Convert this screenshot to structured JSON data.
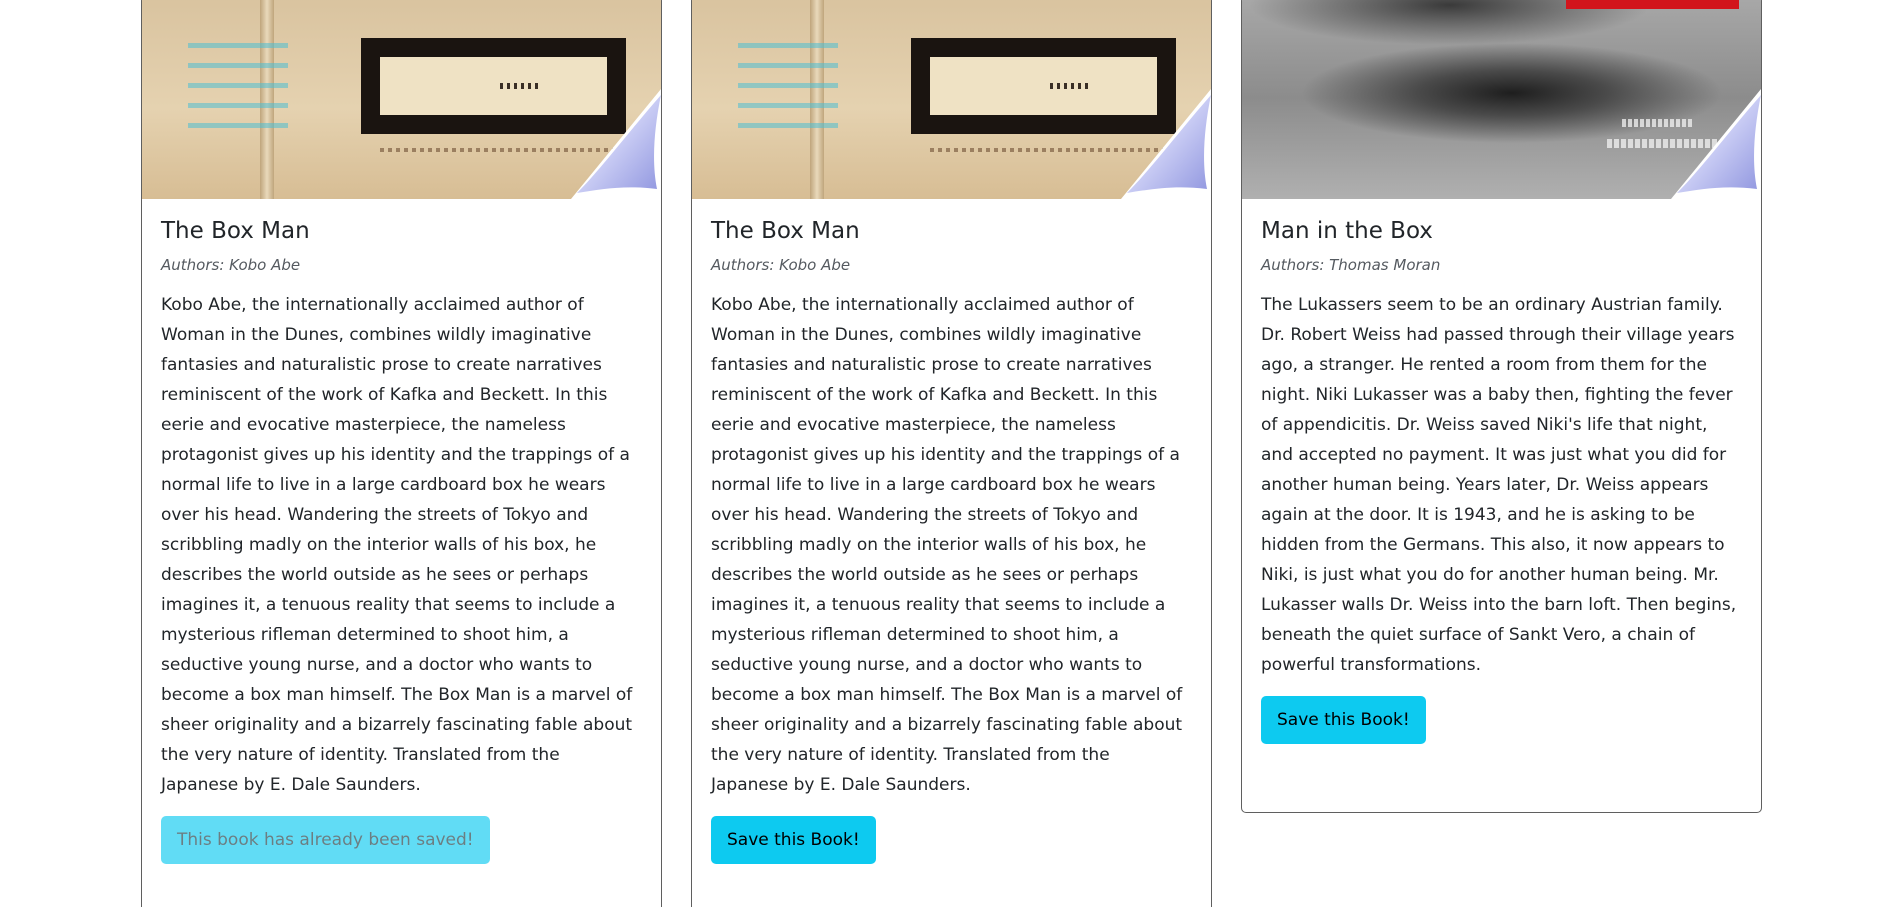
{
  "books": [
    {
      "title": "The Box Man",
      "authors": "Authors: Kobo Abe",
      "description": "Kobo Abe, the internationally acclaimed author of Woman in the Dunes, combines wildly imaginative fantasies and naturalistic prose to create narratives reminiscent of the work of Kafka and Beckett. In this eerie and evocative masterpiece, the nameless protagonist gives up his identity and the trappings of a normal life to live in a large cardboard box he wears over his head. Wandering the streets of Tokyo and scribbling madly on the interior walls of his box, he describes the world outside as he sees or perhaps imagines it, a tenuous reality that seems to include a mysterious rifleman determined to shoot him, a seductive young nurse, and a doctor who wants to become a box man himself. The Box Man is a marvel of sheer originality and a bizarrely fascinating fable about the very nature of identity. Translated from the Japanese by E. Dale Saunders.",
      "button_label": "This book has already been saved!",
      "saved": true,
      "cover_icon": "book-cover-image"
    },
    {
      "title": "The Box Man",
      "authors": "Authors: Kobo Abe",
      "description": "Kobo Abe, the internationally acclaimed author of Woman in the Dunes, combines wildly imaginative fantasies and naturalistic prose to create narratives reminiscent of the work of Kafka and Beckett. In this eerie and evocative masterpiece, the nameless protagonist gives up his identity and the trappings of a normal life to live in a large cardboard box he wears over his head. Wandering the streets of Tokyo and scribbling madly on the interior walls of his box, he describes the world outside as he sees or perhaps imagines it, a tenuous reality that seems to include a mysterious rifleman determined to shoot him, a seductive young nurse, and a doctor who wants to become a box man himself. The Box Man is a marvel of sheer originality and a bizarrely fascinating fable about the very nature of identity. Translated from the Japanese by E. Dale Saunders.",
      "button_label": "Save this Book!",
      "saved": false,
      "cover_icon": "book-cover-image"
    },
    {
      "title": "Man in the Box",
      "authors": "Authors: Thomas Moran",
      "description": "The Lukassers seem to be an ordinary Austrian family. Dr. Robert Weiss had passed through their village years ago, a stranger. He rented a room from them for the night. Niki Lukasser was a baby then, fighting the fever of appendicitis. Dr. Weiss saved Niki's life that night, and accepted no payment. It was just what you did for another human being. Years later, Dr. Weiss appears again at the door. It is 1943, and he is asking to be hidden from the Germans. This also, it now appears to Niki, is just what you do for another human being. Mr. Lukasser walls Dr. Weiss into the barn loft. Then begins, beneath the quiet surface of Sankt Vero, a chain of powerful transformations.",
      "button_label": "Save this Book!",
      "saved": false,
      "cover_icon": "book-cover-image"
    }
  ],
  "colors": {
    "button": "#0dcaf0",
    "card_border": "#5f5f5f",
    "text": "#212529"
  }
}
